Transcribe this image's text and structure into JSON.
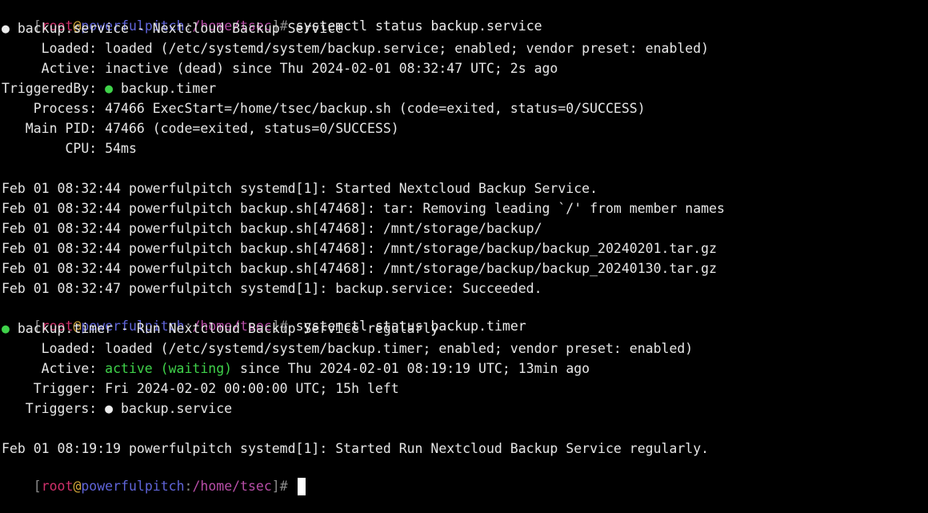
{
  "prompt": {
    "open_bracket": "[",
    "user": "root",
    "at": "@",
    "host": "powerfulpitch",
    "path_sep": ":",
    "path": "/home/tsec",
    "close": "]# "
  },
  "commands": {
    "cmd1": "systemctl status backup.service",
    "cmd2": "systemctl status backup.timer"
  },
  "service": {
    "bullet": "●",
    "header": " backup.service - Nextcloud Backup Service",
    "loaded": "     Loaded: loaded (/etc/systemd/system/backup.service; enabled; vendor preset: enabled)",
    "active": "     Active: inactive (dead) since Thu 2024-02-01 08:32:47 UTC; 2s ago",
    "triggered_label": "TriggeredBy: ",
    "triggered_bullet": "●",
    "triggered_value": " backup.timer",
    "process": "    Process: 47466 ExecStart=/home/tsec/backup.sh (code=exited, status=0/SUCCESS)",
    "main_pid": "   Main PID: 47466 (code=exited, status=0/SUCCESS)",
    "cpu": "        CPU: 54ms",
    "logs": [
      "Feb 01 08:32:44 powerfulpitch systemd[1]: Started Nextcloud Backup Service.",
      "Feb 01 08:32:44 powerfulpitch backup.sh[47468]: tar: Removing leading `/' from member names",
      "Feb 01 08:32:44 powerfulpitch backup.sh[47468]: /mnt/storage/backup/",
      "Feb 01 08:32:44 powerfulpitch backup.sh[47468]: /mnt/storage/backup/backup_20240201.tar.gz",
      "Feb 01 08:32:44 powerfulpitch backup.sh[47468]: /mnt/storage/backup/backup_20240130.tar.gz",
      "Feb 01 08:32:47 powerfulpitch systemd[1]: backup.service: Succeeded."
    ]
  },
  "timer": {
    "bullet": "●",
    "header": " backup.timer - Run Nextcloud Backup Service regularly",
    "loaded": "     Loaded: loaded (/etc/systemd/system/backup.timer; enabled; vendor preset: enabled)",
    "active_label": "     Active: ",
    "active_state": "active (waiting)",
    "active_rest": " since Thu 2024-02-01 08:19:19 UTC; 13min ago",
    "trigger": "    Trigger: Fri 2024-02-02 00:00:00 UTC; 15h left",
    "triggers_label": "   Triggers: ",
    "triggers_bullet": "●",
    "triggers_value": " backup.service",
    "log": "Feb 01 08:19:19 powerfulpitch systemd[1]: Started Run Nextcloud Backup Service regularly."
  },
  "colors": {
    "background": "#000000",
    "text": "#e6e6e6",
    "user": "#d0306b",
    "host": "#5f64d8",
    "path": "#b84ea8",
    "active_green": "#3fd24a"
  }
}
